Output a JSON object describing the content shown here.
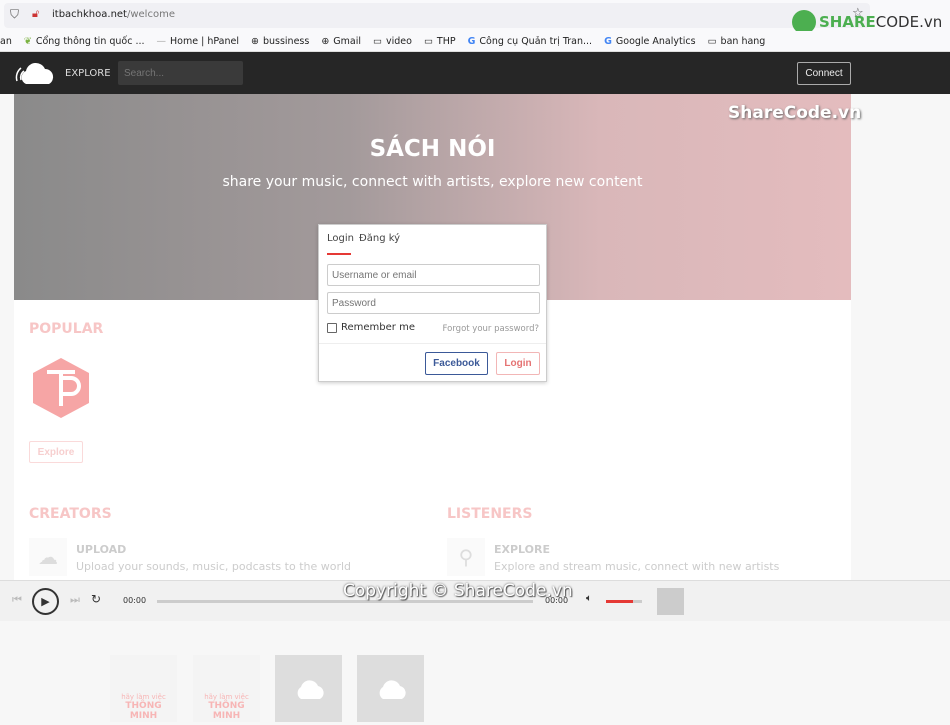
{
  "browser": {
    "url_host": "itbachkhoa.net",
    "url_path": "/welcome",
    "bookmarks": [
      "an",
      "Cổng thông tin quốc ...",
      "Home | hPanel",
      "bussiness",
      "Gmail",
      "video",
      "THP",
      "Công cụ Quản trị Tran...",
      "Google Analytics",
      "ban hang"
    ]
  },
  "watermark": {
    "logo": "SHARECODE.vn",
    "corner": "ShareCode.vn",
    "copyright": "Copyright © ShareCode.vn"
  },
  "nav": {
    "explore": "EXPLORE",
    "search_placeholder": "Search...",
    "connect": "Connect"
  },
  "hero": {
    "title": "SÁCH NÓI",
    "subtitle": "share your music, connect with artists, explore new content"
  },
  "login": {
    "tabs": [
      "Login",
      "Đăng ký"
    ],
    "username_placeholder": "Username or email",
    "password_placeholder": "Password",
    "remember": "Remember me",
    "forgot": "Forgot your password?",
    "facebook": "Facebook",
    "submit": "Login"
  },
  "popular": {
    "title": "POPULAR",
    "explore_button": "Explore",
    "book_text": [
      "hãy làm việc",
      "THÔNG",
      "MINH"
    ]
  },
  "creators": {
    "title": "CREATORS",
    "item_title": "UPLOAD",
    "item_desc": "Upload your sounds, music, podcasts to the world"
  },
  "listeners": {
    "title": "LISTENERS",
    "item_title": "EXPLORE",
    "item_desc": "Explore and stream music, connect with new artists"
  },
  "player": {
    "current": "00:00",
    "duration": "00:00",
    "progress": 0,
    "volume": 0.75,
    "accent": "#e53935"
  }
}
